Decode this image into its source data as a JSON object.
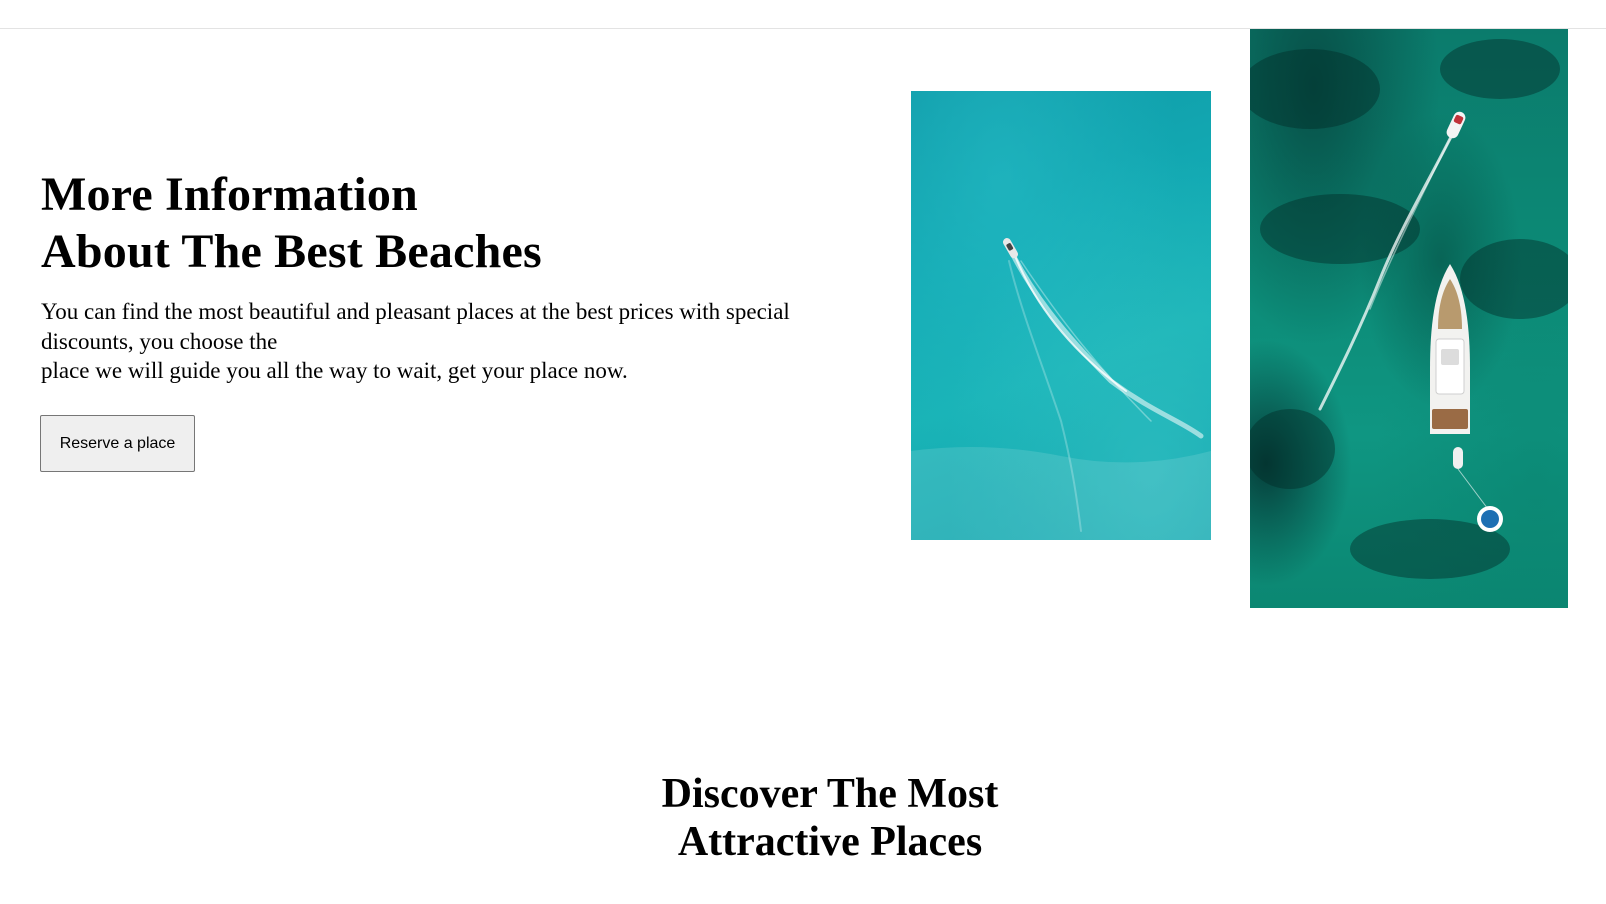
{
  "hero": {
    "title_line1": "More Information",
    "title_line2": "About The Best Beaches",
    "description_line1": "You can find the most beautiful and pleasant places at the best prices with special discounts, you choose the",
    "description_line2": "place we will guide you all the way to wait, get your place now.",
    "reserve_button_label": "Reserve a place"
  },
  "photos": {
    "small_icon": "aerial-speedboat-photo",
    "large_icon": "aerial-yacht-photo"
  },
  "section": {
    "title_line1": "Discover The Most",
    "title_line2": "Attractive Places"
  },
  "colors": {
    "button_bg": "#efefef",
    "button_border": "#767676",
    "sea_turquoise": "#13aab3",
    "sea_green": "#0c8a76"
  }
}
